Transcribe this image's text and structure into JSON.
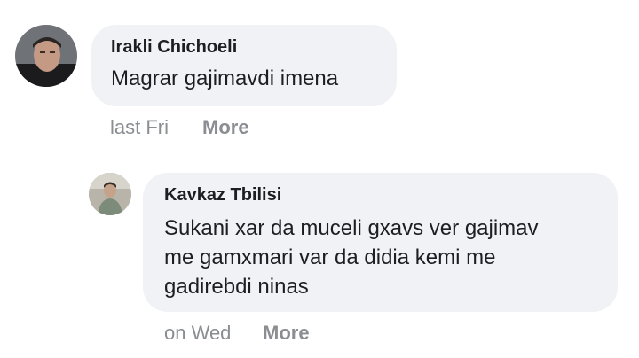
{
  "comments": [
    {
      "author": "Irakli Chichoeli",
      "text": "Magrar gajimavdi imena",
      "timestamp": "last Fri",
      "more_label": "More",
      "avatar_icon": "user-photo"
    },
    {
      "author": "Kavkaz Tbilisi",
      "text_lines": [
        "Sukani xar da muceli gxavs ver gajimav",
        "me gamxmari var da didia kemi me",
        "gadirebdi ninas"
      ],
      "timestamp": "on Wed",
      "more_label": "More",
      "avatar_icon": "user-photo"
    }
  ],
  "colors": {
    "bubble_bg": "#f0f2f5",
    "author_text": "#1c1e21",
    "meta_text": "#8a8d91"
  }
}
